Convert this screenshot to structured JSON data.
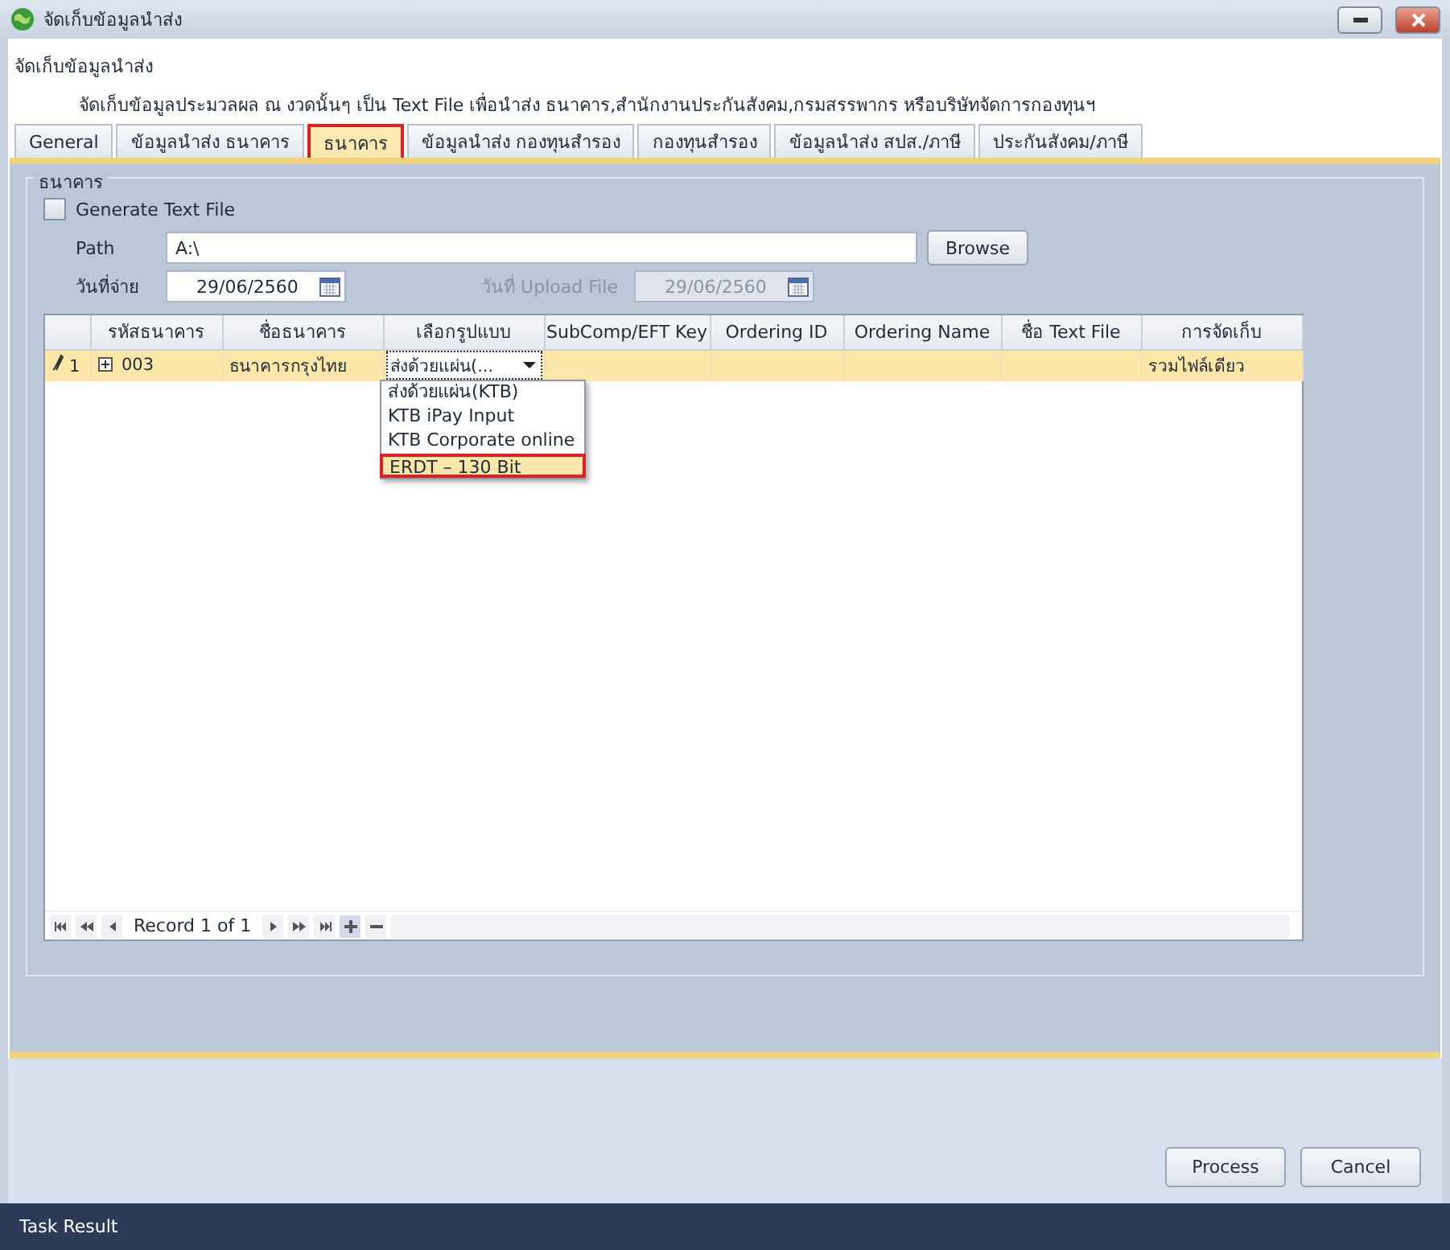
{
  "window": {
    "title": "จัดเก็บข้อมูลนำส่ง"
  },
  "header": {
    "title": "จัดเก็บข้อมูลนำส่ง",
    "description": "จัดเก็บข้อมูลประมวลผล ณ งวดนั้นๆ เป็น Text File เพื่อนำส่ง ธนาคาร,สำนักงานประกันสังคม,กรมสรรพากร หรือบริษัทจัดการกองทุนฯ"
  },
  "tabs": [
    {
      "label": "General",
      "selected": false
    },
    {
      "label": "ข้อมูลนำส่ง ธนาคาร",
      "selected": false
    },
    {
      "label": "ธนาคาร",
      "selected": true
    },
    {
      "label": "ข้อมูลนำส่ง กองทุนสำรอง",
      "selected": false
    },
    {
      "label": "กองทุนสำรอง",
      "selected": false
    },
    {
      "label": "ข้อมูลนำส่ง สปส./ภาษี",
      "selected": false
    },
    {
      "label": "ประกันสังคม/ภาษี",
      "selected": false
    }
  ],
  "group": {
    "title": "ธนาคาร",
    "generate": {
      "label": "Generate Text File",
      "checked": false
    },
    "path": {
      "label": "Path",
      "value": "A:\\"
    },
    "browse_button": "Browse",
    "pay_date": {
      "label": "วันที่จ่าย",
      "value": "29/06/2560",
      "disabled": false
    },
    "upload_date": {
      "label": "วันที่ Upload File",
      "value": "29/06/2560",
      "disabled": true
    },
    "grid": {
      "columns": [
        "รหัสธนาคาร",
        "ชื่อธนาคาร",
        "เลือกรูปแบบ",
        "SubComp/EFT Key",
        "Ordering ID",
        "Ordering Name",
        "ชื่อ Text File",
        "การจัดเก็บ"
      ],
      "rows": [
        {
          "indicator": "1",
          "code": "003",
          "name": "ธนาคารกรุงไทย",
          "format": "ส่งด้วยแผ่น(...",
          "subcomp": "",
          "ordering_id": "",
          "ordering_name": "",
          "text_file": "",
          "storage": "รวมไฟล์เดียว",
          "selected": true
        }
      ],
      "dropdown": [
        {
          "label": "ส่งด้วยแผ่น(KTB)",
          "selected": false
        },
        {
          "label": "KTB iPay Input",
          "selected": false
        },
        {
          "label": "KTB Corporate online",
          "selected": false
        },
        {
          "label": "ERDT – 130 Bit",
          "selected": true
        }
      ],
      "navigator": "Record 1 of 1"
    }
  },
  "buttons": [
    "Process",
    "Cancel"
  ],
  "status_bar": "Task Result"
}
